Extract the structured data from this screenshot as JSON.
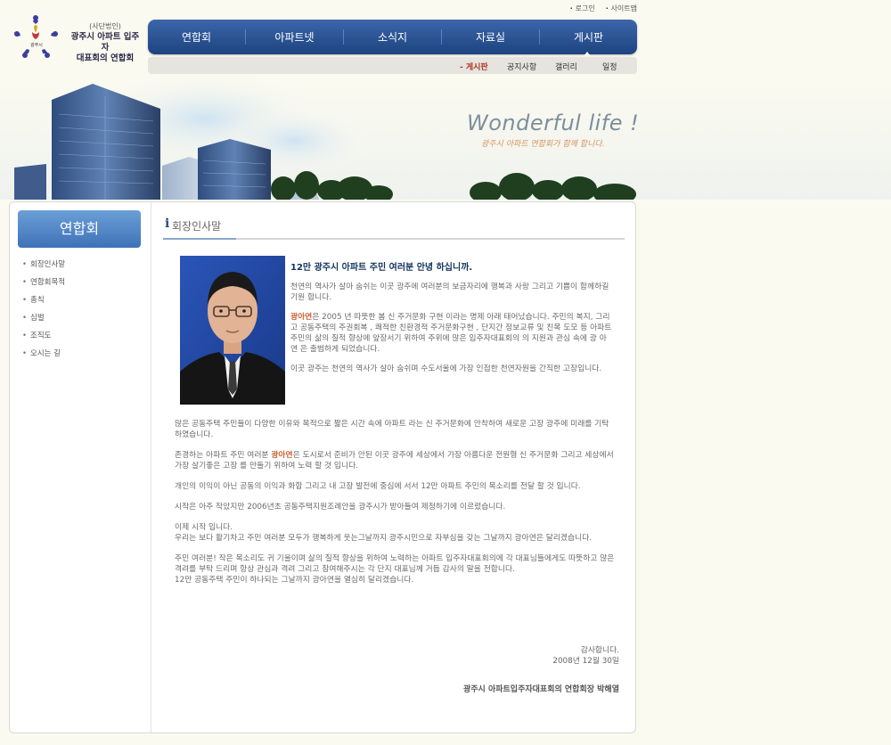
{
  "top_links": [
    "로그인",
    "사이트맵"
  ],
  "logo": {
    "emblem_text": "광주시",
    "line1": "(사단법인)",
    "line2": "광주시 아파트 입주자",
    "line3": "대표회의 연합회"
  },
  "main_nav": [
    "연합회",
    "아파트넷",
    "소식지",
    "자료실",
    "게시판"
  ],
  "sub_nav": {
    "items": [
      "게시판",
      "공지사항",
      "갤러리",
      "일정"
    ],
    "active_prefix": "- "
  },
  "banner": {
    "title": "Wonderful  life !",
    "subtitle": "광주시 아파트 연합회가 함께 합니다."
  },
  "sidebar": {
    "title": "연합회",
    "items": [
      "회장인사말",
      "연합회목적",
      "총칙",
      "심벌",
      "조직도",
      "오시는 길"
    ]
  },
  "page": {
    "heading_icon": "i",
    "heading": "회장인사말",
    "intro_title": "12만 광주시 아파트 주민 여러분 안녕 하십니까.",
    "p1": "천연의 역사가 살아 숨쉬는 이곳 광주에 여러분의 보금자리에 행복과 사랑 그리고 기쁨이 함께하길 기원 합니다.",
    "p2_hl": "광아연",
    "p2": "은 2005 년 따뜻한 봄 신 주거문화 구현 이라는 명제 아래 태어났습니다. 주민의 복지, 그리고 공동주택의 주권회복 , 쾌적한 친환경적 주거문화구현 , 단지간 정보교류 및 친목 도모 등 아파트 주민의 삶의 질적 향상에 앞장서기 위하여 주위에 많은 입주자대표회의 의 지원과 관심 속에 광 아 연 은 출범하게 되었습니다.",
    "p3": "이곳 광주는 천연의 역사가 살아 숨쉬며 수도서울에 가장 인접한 천연자원을 간직한 고장입니다.",
    "p4": "많은 공동주택 주민들이 다양한 이유와 목적으로 짧은 시간 속에 아파트 라는 신 주거문화에 안착하여 새로운 고장 광주에 미래를 기탁 하였습니다.",
    "p5_a": "존경하는 아파트 주민 여러분 ",
    "p5_hl": "광아연",
    "p5_b": "은 도시로서 준비가 안된 이곳 광주에 세상에서 가장 아름다운 전원형 신 주거문화 그리고 세상에서 가장 살기좋은 고장 를 만들기 위하여 노력 할 것 입니다.",
    "p6": "개인의 이익이 아닌 공동의 이익과 화합 그리고 내 고장 발전에 중심에 서서 12만 아파트 주민의 목소리를 전달 할 것 입니다.",
    "p7": "시작은 아주 작았지만 2006년초 공동주택지원조례안을 광주시가 받아들여 제정하기에 이르렀습니다.",
    "p8_a": "이제 시작 입니다.",
    "p8_b": "우리는 보다 활기차고 주민 여러분 모두가 행복하게 웃는그날까지 광주시민으로 자부심을 갖는 그날까지 광아연은 달리겠습니다.",
    "p9_a": "주민 여러분! 작은 목소리도 귀 기울이며 삶의 질적 향상을 위하여 노력하는 아파트 입주자대표회의에 각 대표님들에게도 따뜻하고 많은 격려를 부탁 드리며 항상 관심과 격려 그리고 참여해주시는 각 단지 대표님께 거듭 감사의 말을 전합니다.",
    "p9_b": "12만 공동주택 주민이 하나되는 그날까지 광아연을 열심히 달리겠습니다.",
    "thanks": "감사합니다.",
    "date": "2008년 12월 30일",
    "signature": "광주시 아파트입주자대표회의 연합회장 박해열"
  },
  "colors": {
    "nav": "#2a5596",
    "highlight": "#c9602f",
    "heading": "#12335e"
  }
}
